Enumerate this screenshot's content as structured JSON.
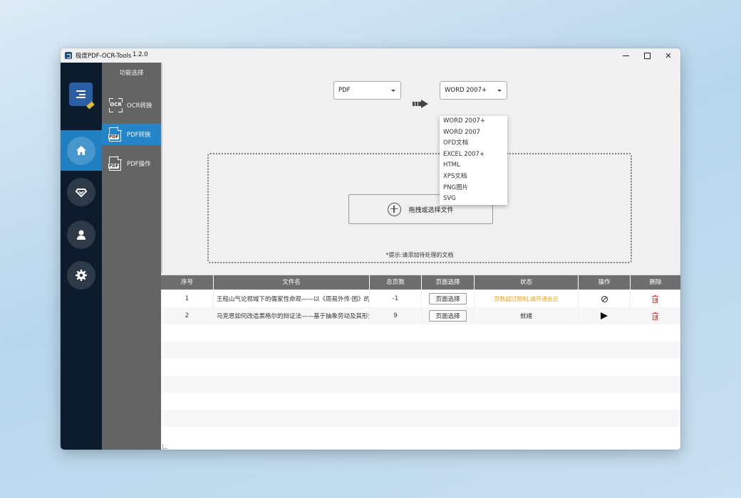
{
  "window": {
    "title": "极度PDF-OCR-Tools",
    "version": "1.2.0",
    "controls": [
      "minimize",
      "maximize",
      "close"
    ]
  },
  "rail": {
    "logo_icon": "app-logo-icon",
    "items": [
      {
        "icon": "home-icon",
        "active": true
      },
      {
        "icon": "diamond-icon",
        "active": false
      },
      {
        "icon": "user-icon",
        "active": false
      },
      {
        "icon": "gear-icon",
        "active": false
      }
    ],
    "accent_color": "#1f7fc0"
  },
  "sidebar": {
    "title": "功能选择",
    "items": [
      {
        "label": "OCR转换",
        "icon": "ocr-icon",
        "active": false
      },
      {
        "label": "PDF转换",
        "icon": "pdf-document-icon",
        "active": true
      },
      {
        "label": "PDF操作",
        "icon": "pdf-document-icon",
        "active": false
      }
    ]
  },
  "converter": {
    "source_format": "PDF",
    "target_format": "WORD 2007+",
    "target_options": [
      "WORD 2007+",
      "WORD 2007",
      "OFD文档",
      "EXCEL 2007+",
      "HTML",
      "XPS文档",
      "PNG图片",
      "SVG"
    ]
  },
  "dropzone": {
    "button_label": "拖拽或选择文件",
    "hint": "*提示:请添加待处理的文档"
  },
  "table": {
    "columns": [
      "序号",
      "文件名",
      "总页数",
      "页面选择",
      "状态",
      "操作",
      "删除"
    ],
    "rows": [
      {
        "index": "1",
        "filename": "王船山气论视域下的儒家性命观——以《周易外传·困》的",
        "pages": "-1",
        "page_select_label": "页面选择",
        "status": "页数超过限制,请开通会员",
        "status_color": "#e8a317",
        "action_icon": "ban-icon"
      },
      {
        "index": "2",
        "filename": "马克思如何改造黑格尔的辩证法——基于抽象劳动及其形式",
        "pages": "9",
        "page_select_label": "页面选择",
        "status": "就绪",
        "status_color": "#333333",
        "action_icon": "play-icon"
      }
    ]
  }
}
